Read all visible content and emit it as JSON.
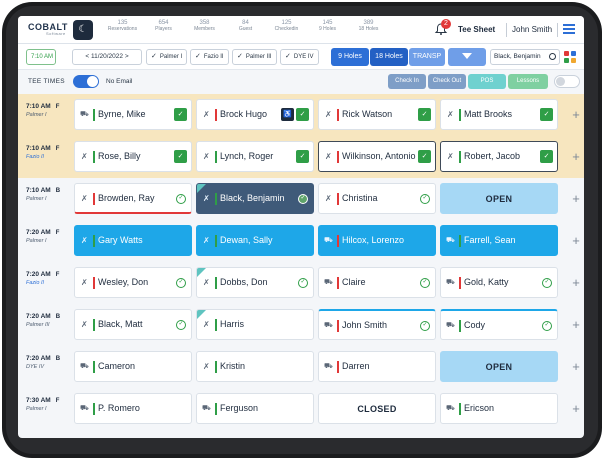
{
  "header": {
    "logo": "COBALT",
    "logo_sub": "Software",
    "stats": [
      {
        "value": "135",
        "label": "Reservations"
      },
      {
        "value": "654",
        "label": "Players"
      },
      {
        "value": "358",
        "label": "Members"
      },
      {
        "value": "84",
        "label": "Guest"
      },
      {
        "value": "125",
        "label": "Checkedin"
      },
      {
        "value": "145",
        "label": "9 Holes"
      },
      {
        "value": "389",
        "label": "18 Holes"
      }
    ],
    "notification_count": "2",
    "tee_sheet_link": "Tee Sheet",
    "user_name": "John Smith"
  },
  "filters": {
    "time": "7:10 AM",
    "date": "< 11/20/2022 >",
    "courses": [
      "Palmer I",
      "Fazio II",
      "Palmer III",
      "DYE IV"
    ],
    "buttons": {
      "nine_holes": "9 Holes",
      "eighteen_holes": "18 Holes",
      "transp": "TRANSP"
    },
    "search_value": "Black, Benjamin"
  },
  "subheader": {
    "tee_times_label": "TEE TIMES",
    "no_email_label": "No Email",
    "actions": {
      "check_in": "Check In",
      "check_out": "Check Out",
      "pos": "POS",
      "lessons": "Lessons"
    }
  },
  "rows": [
    {
      "time": "7:10 AM",
      "flag": "F",
      "course": "Palmer I",
      "slots": [
        "Byrne, Mike",
        "Brock Hugo",
        "Rick Watson",
        "Matt Brooks"
      ]
    },
    {
      "time": "7:10 AM",
      "flag": "F",
      "course": "Fazio II",
      "slots": [
        "Rose, Billy",
        "Lynch, Roger",
        "Wilkinson, Antonio",
        "Robert, Jacob"
      ]
    },
    {
      "time": "7:10 AM",
      "flag": "B",
      "course": "Palmer I",
      "slots": [
        "Browden, Ray",
        "Black, Benjamin",
        "Christina",
        "OPEN"
      ]
    },
    {
      "time": "7:20 AM",
      "flag": "F",
      "course": "Palmer I",
      "slots": [
        "Gary Watts",
        "Dewan, Sally",
        "Hilcox, Lorenzo",
        "Farrell, Sean"
      ]
    },
    {
      "time": "7:20 AM",
      "flag": "F",
      "course": "Fazio II",
      "slots": [
        "Wesley, Don",
        "Dobbs, Don",
        "Claire",
        "Gold, Katty"
      ]
    },
    {
      "time": "7:20 AM",
      "flag": "B",
      "course": "Palmer III",
      "slots": [
        "Black, Matt",
        "Harris",
        "John Smith",
        "Cody"
      ]
    },
    {
      "time": "7:20 AM",
      "flag": "B",
      "course": "DYE IV",
      "slots": [
        "Cameron",
        "Kristin",
        "Darren",
        "OPEN"
      ]
    },
    {
      "time": "7:30 AM",
      "flag": "F",
      "course": "Palmer I",
      "slots": [
        "P. Romero",
        "Ferguson",
        "CLOSED",
        "Ericson"
      ]
    }
  ],
  "colors": {
    "accent": "#2d6fd6",
    "paid": "#2f9e47",
    "highlight_row": "#f7e6bf",
    "checked_in": "#1ea7e8",
    "selected": "#3f5a79",
    "open": "#a6d8f5"
  }
}
